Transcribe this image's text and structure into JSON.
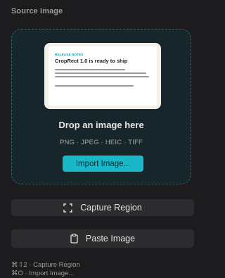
{
  "panel": {
    "title": "Source Image"
  },
  "drop_zone": {
    "preview": {
      "kicker": "RELEASE NOTES",
      "headline": "CropRect 1.0 is ready to ship"
    },
    "title": "Drop an image here",
    "formats": "PNG · JPEG · HEIC · TIFF",
    "import_label": "Import Image..."
  },
  "actions": {
    "capture_label": "Capture Region",
    "paste_label": "Paste Image"
  },
  "shortcuts": {
    "capture": "⌘⇧2 · Capture Region",
    "import": "⌘O · Import Image..."
  },
  "colors": {
    "accent": "#19b8c9",
    "background": "#1c1c1e",
    "drop_border": "#2f6a66"
  }
}
